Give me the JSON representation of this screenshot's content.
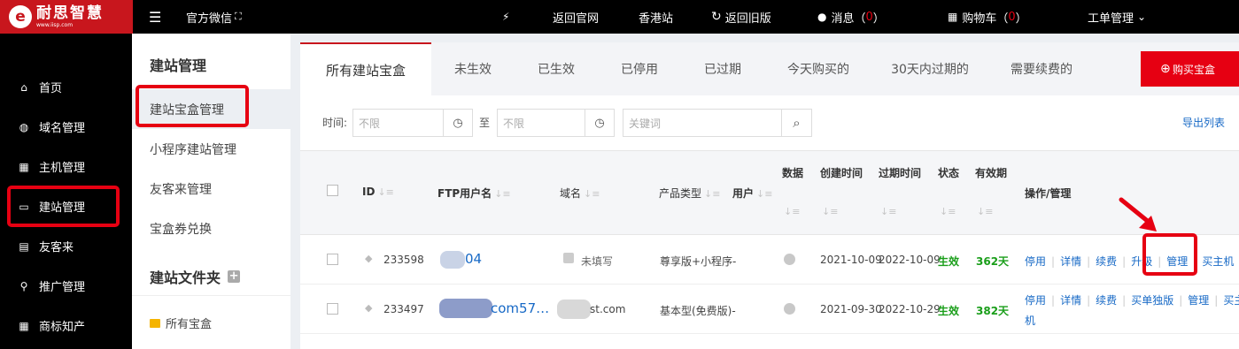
{
  "brand": {
    "name": "耐思智慧",
    "url": "www.iisp.com",
    "mark": "e"
  },
  "topbar": {
    "menu_icon": "☰",
    "wechat": "官方微信",
    "wechat_icon": "⛶",
    "wand_icon": "⚡",
    "back_official": "返回官网",
    "hk_site": "香港站",
    "refresh_icon": "↻",
    "back_old": "返回旧版",
    "msg_icon": "●",
    "messages": "消息",
    "msg_open": "（",
    "msg_count": "0",
    "msg_close": "）",
    "cart_icon": "▦",
    "cart": "购物车",
    "cart_open": "（",
    "cart_count": "0",
    "cart_close": "）",
    "ticket": "工单管理",
    "chevron": "⌄"
  },
  "sidebar": {
    "items": [
      {
        "icon": "⌂",
        "label": "首页"
      },
      {
        "icon": "◍",
        "label": "域名管理"
      },
      {
        "icon": "▦",
        "label": "主机管理"
      },
      {
        "icon": "▭",
        "label": "建站管理"
      },
      {
        "icon": "▤",
        "label": "友客来"
      },
      {
        "icon": "⚲",
        "label": "推广管理"
      },
      {
        "icon": "▦",
        "label": "商标知产"
      }
    ]
  },
  "subnav": {
    "title": "建站管理",
    "items": [
      "建站宝盒管理",
      "小程序建站管理",
      "友客来管理",
      "宝盒券兑换"
    ],
    "folder_title": "建站文件夹",
    "folder_add": "+",
    "folder_item": "所有宝盒"
  },
  "tabs": [
    "所有建站宝盒",
    "未生效",
    "已生效",
    "已停用",
    "已过期",
    "今天购买的",
    "30天内过期的",
    "需要续费的"
  ],
  "buy_button": {
    "icon": "⊕",
    "label": "购买宝盒"
  },
  "filter": {
    "time_label": "时间:",
    "from_placeholder": "不限",
    "to_label": "至",
    "to_placeholder": "不限",
    "keyword_placeholder": "关键词",
    "clock": "◷",
    "search": "⌕",
    "export": "导出列表"
  },
  "table": {
    "sort_icon": "↓≡",
    "headers": {
      "id": "ID",
      "ftp": "FTP用户名",
      "domain": "域名",
      "product": "产品类型",
      "user": "用户",
      "data": "数据",
      "created": "创建时间",
      "expire": "过期时间",
      "status": "状态",
      "validity": "有效期",
      "actions": "操作/管理"
    },
    "rows": [
      {
        "id": "233598",
        "ftp": "04",
        "domain": "未填写",
        "product": "尊享版+小程序-",
        "created": "2021-10-09",
        "expire": "2022-10-09",
        "status": "生效",
        "validity": "362天",
        "actions": [
          "停用",
          "详情",
          "续费",
          "升级",
          "管理",
          "买主机"
        ]
      },
      {
        "id": "233497",
        "ftp": "com57…",
        "domain": "st.com",
        "product": "基本型(免费版)-",
        "created": "2021-09-30",
        "expire": "2022-10-29",
        "status": "生效",
        "validity": "382天",
        "actions": [
          "停用",
          "详情",
          "续费",
          "买单独版",
          "管理",
          "买主"
        ],
        "actions_wrap": "机"
      }
    ]
  },
  "colors": {
    "brand_red": "#c8161d",
    "highlight_red": "#e60012",
    "link": "#1769c6",
    "status_green": "#1a9e1a"
  }
}
